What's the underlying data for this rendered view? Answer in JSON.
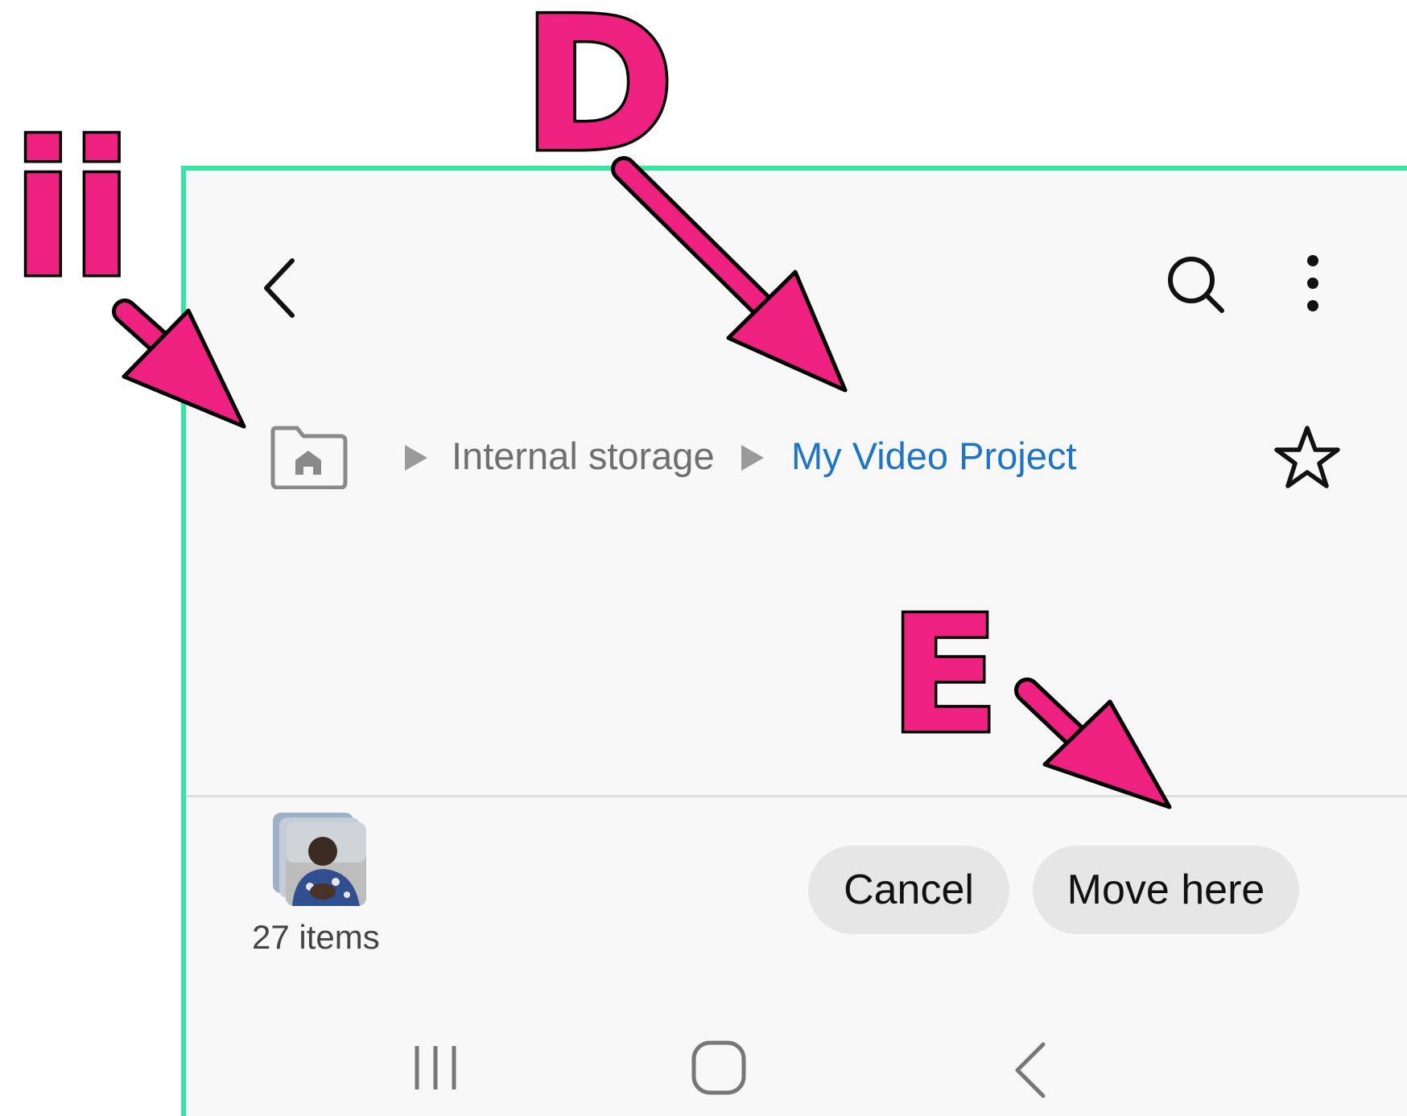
{
  "annotations": {
    "label_ii": "ii",
    "label_d": "D",
    "label_e": "E",
    "accent_color": "#ee2080",
    "frame_color": "#34e6a2"
  },
  "app_bar": {
    "back_icon": "chevron-left-icon",
    "search_icon": "search-icon",
    "more_icon": "more-vertical-icon"
  },
  "breadcrumb": {
    "home_icon": "home-folder-icon",
    "separator_icon": "triangle-right-icon",
    "items": [
      "Internal storage",
      "My Video Project"
    ],
    "current_color": "#1f74c4",
    "favorite_icon": "star-outline-icon"
  },
  "bottom_bar": {
    "items_count": "27 items",
    "cancel_label": "Cancel",
    "move_label": "Move here"
  },
  "nav_bar": {
    "recents_icon": "recents-icon",
    "home_icon": "home-circle-icon",
    "back_icon": "nav-back-icon"
  }
}
